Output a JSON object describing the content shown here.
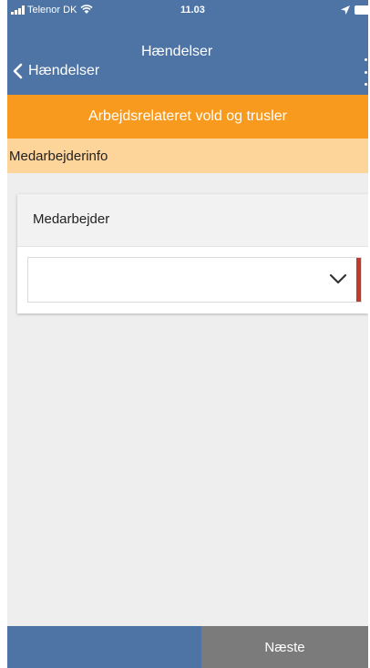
{
  "status_bar": {
    "carrier": "Telenor DK",
    "time": "11.03",
    "icons": [
      "signal-icon",
      "wifi-icon",
      "location-icon",
      "battery-icon"
    ]
  },
  "nav": {
    "title": "Hændelser",
    "back_label": "Hændelser",
    "back_icon": "chevron-left-icon",
    "menu_icon": "more-vertical-icon"
  },
  "form": {
    "title": "Arbejdsrelateret vold og trusler",
    "section": "Medarbejderinfo",
    "fields": [
      {
        "label": "Medarbejder",
        "value": "",
        "icon": "chevron-down-icon",
        "required": true
      }
    ]
  },
  "footer": {
    "next_label": "Næste"
  },
  "colors": {
    "header": "#4e74a6",
    "banner": "#f79a1e",
    "section": "#fdd49a",
    "background": "#eeeeee",
    "required": "#c0392b",
    "next_button": "#7b7b7b"
  }
}
